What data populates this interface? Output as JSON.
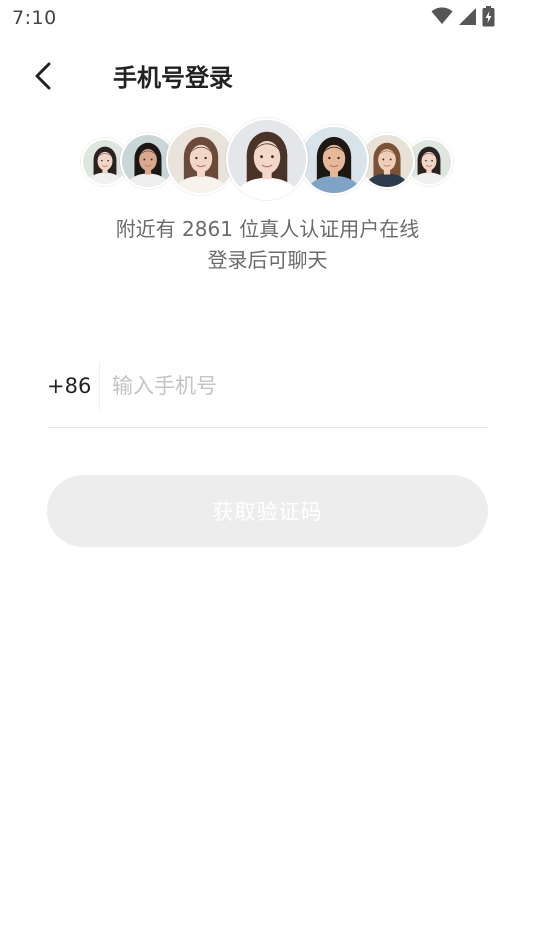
{
  "status_bar": {
    "time": "7:10",
    "icons": [
      "wifi-icon",
      "cellular-signal-icon",
      "battery-charging-icon"
    ]
  },
  "header": {
    "back_icon": "chevron-left-icon",
    "title": "手机号登录"
  },
  "avatars": {
    "count": 7,
    "items": [
      {
        "name": "avatar-1",
        "bg": "#dfe6df",
        "skin": "#f1d6c6",
        "hair": "#2b2220",
        "shirt": "#f0f0f0"
      },
      {
        "name": "avatar-2",
        "bg": "#c9d6d8",
        "skin": "#d8a98d",
        "hair": "#1c1714",
        "shirt": "#eeeeee"
      },
      {
        "name": "avatar-3",
        "bg": "#e9e3dc",
        "skin": "#f2d7c8",
        "hair": "#6b4a3a",
        "shirt": "#f7f2ec"
      },
      {
        "name": "avatar-4",
        "bg": "#e4e6ea",
        "skin": "#f3d8c9",
        "hair": "#4a3328",
        "shirt": "#ffffff"
      },
      {
        "name": "avatar-5",
        "bg": "#d9e4ea",
        "skin": "#e6b89a",
        "hair": "#1e1814",
        "shirt": "#7fa3c4"
      },
      {
        "name": "avatar-6",
        "bg": "#e8e2d6",
        "skin": "#f0cfb8",
        "hair": "#7a5236",
        "shirt": "#2d3a4a"
      },
      {
        "name": "avatar-7",
        "bg": "#dfe6df",
        "skin": "#f1d6c6",
        "hair": "#2b2220",
        "shirt": "#f0f0f0"
      }
    ]
  },
  "promo": {
    "line1": "附近有 2861 位真人认证用户在线",
    "line2": "登录后可聊天"
  },
  "phone": {
    "country_code": "+86",
    "placeholder": "输入手机号",
    "value": ""
  },
  "submit": {
    "label": "获取验证码",
    "enabled": false
  },
  "colors": {
    "title": "#222222",
    "promo_text": "#6b6b6b",
    "placeholder": "#c4c4c4",
    "button_disabled_bg": "#ededed",
    "button_text": "#ffffff",
    "divider": "#e8e8e8"
  }
}
